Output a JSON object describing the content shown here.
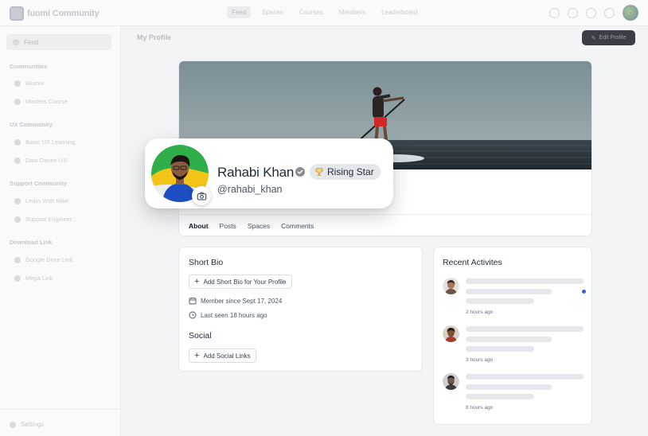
{
  "app": {
    "brand": "fuomi Community",
    "nav": [
      "Feed",
      "Spaces",
      "Courses",
      "Members",
      "Leaderboard"
    ],
    "page_title": "My Profile",
    "edit_profile_label": "Edit Profile"
  },
  "sidebar": {
    "feed_label": "Feed",
    "groups": [
      {
        "title": "Communities",
        "items": [
          "Alumni",
          "Masters Course"
        ]
      },
      {
        "title": "UX Community",
        "items": [
          "Basic UX Learning",
          "Data Driven UX"
        ]
      },
      {
        "title": "Support Community",
        "items": [
          "Learn With Mike",
          "Support Engineer..."
        ]
      },
      {
        "title": "Download Link",
        "items": [
          "Google Drive Link",
          "Mega Link"
        ]
      }
    ],
    "settings_label": "Settings"
  },
  "profile": {
    "name": "Rahabi Khan",
    "handle": "@rahabi_khan",
    "badge": "Rising Star",
    "tabs": [
      "About",
      "Posts",
      "Spaces",
      "Comments"
    ],
    "active_tab": "About"
  },
  "bio": {
    "short_bio_title": "Short Bio",
    "add_bio_label": "Add Short Bio for Your Profile",
    "member_since": "Member since Sept 17, 2024",
    "last_seen": "Last seen 18 hours ago",
    "social_title": "Social",
    "add_social_label": "Add Social Links"
  },
  "activity": {
    "title": "Recent Activites",
    "items": [
      {
        "time": "2 hours ago",
        "unread": true
      },
      {
        "time": "3 hours ago",
        "unread": false
      },
      {
        "time": "8 hours ago",
        "unread": false
      }
    ]
  },
  "colors": {
    "accent_unread": "#3b5bdb",
    "avatar_ring_green": "#2fae4a",
    "avatar_ring_yellow": "#f2c418",
    "avatar_shirt": "#1e4fc2"
  },
  "icons": {
    "verified": "check-badge-icon",
    "badge": "trophy-icon",
    "camera": "camera-icon",
    "calendar": "calendar-icon",
    "clock": "clock-icon",
    "plus": "plus-icon"
  }
}
